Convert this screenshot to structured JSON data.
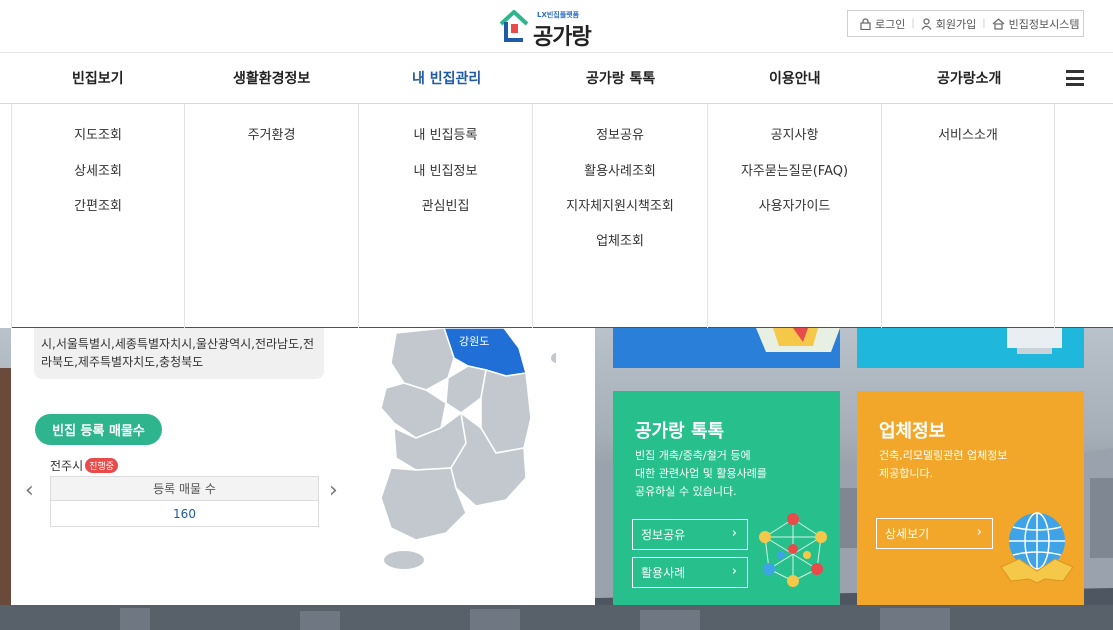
{
  "header": {
    "logo_tag": "LX빈집플랫폼",
    "logo_name": "공가랑",
    "util": [
      {
        "label": "로그인",
        "icon": "lock-icon"
      },
      {
        "label": "회원가입",
        "icon": "user-icon"
      },
      {
        "label": "빈집정보시스템",
        "icon": "home-icon"
      }
    ]
  },
  "gnb": {
    "items": [
      "빈집보기",
      "생활환경정보",
      "내 빈집관리",
      "공가랑 톡톡",
      "이용안내",
      "공가랑소개"
    ],
    "active": "내 빈집관리"
  },
  "dropdown": {
    "columns": [
      [
        "지도조회",
        "상세조회",
        "간편조회"
      ],
      [
        "주거환경"
      ],
      [
        "내 빈집등록",
        "내 빈집정보",
        "관심빈집"
      ],
      [
        "정보공유",
        "활용사례조회",
        "지자체지원시책조회",
        "업체조회"
      ],
      [
        "공지사항",
        "자주묻는질문(FAQ)",
        "사용자가이드"
      ],
      [
        "서비스소개"
      ]
    ]
  },
  "card": {
    "region_text": "시,서울특별시,세종특별자치시,울산광역시,전라남도,전라북도,제주특별자치도,충청북도",
    "pill": "빈집 등록 매물수",
    "city": "전주시",
    "badge": "진행중",
    "table_header": "등록 매물 수",
    "table_value": "160",
    "map_label": "강원도"
  },
  "tiles": {
    "talk": {
      "title": "공가랑 톡톡",
      "desc_lines": [
        "빈집 개축/증축/철거 등에",
        "대한 관련사업 및 활용사례를",
        "공유하실 수 있습니다."
      ],
      "btn1": "정보공유",
      "btn2": "활용사례"
    },
    "company": {
      "title": "업체정보",
      "desc_lines": [
        "건축,리모델링관련 업체정보",
        "제공합니다."
      ],
      "btn": "상세보기"
    }
  },
  "colors": {
    "primary_blue": "#1f5aa6",
    "green_tile": "#27c08c",
    "orange_tile": "#f2a72a",
    "blue_tile": "#2a80d8",
    "cyan_tile": "#1fb7dc"
  }
}
